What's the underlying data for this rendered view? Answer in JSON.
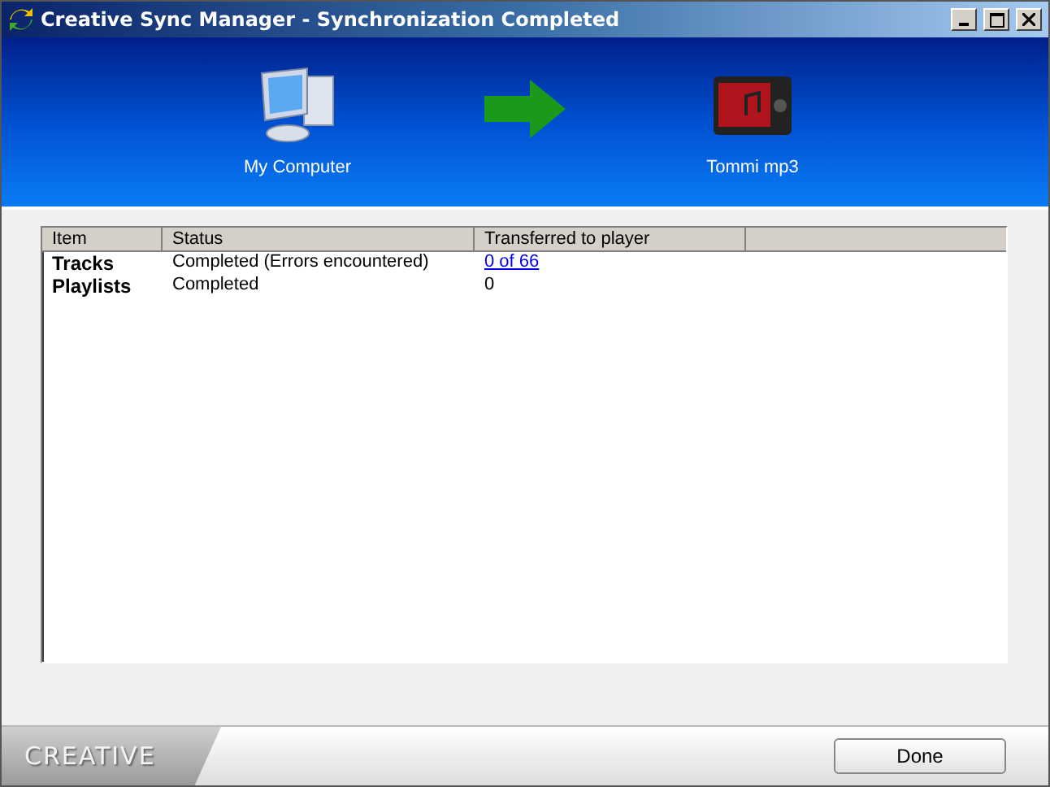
{
  "window": {
    "title": "Creative Sync Manager - Synchronization Completed"
  },
  "header": {
    "source": "My Computer",
    "target": "Tommi mp3"
  },
  "table": {
    "columns": [
      "Item",
      "Status",
      "Transferred to player"
    ],
    "rows": [
      {
        "item": "Tracks",
        "status": "Completed (Errors encountered)",
        "transferred": "0 of 66",
        "kind": "link"
      },
      {
        "item": "Playlists",
        "status": "Completed",
        "transferred": "0",
        "kind": "text"
      }
    ]
  },
  "footer": {
    "logo": "CREATIVE",
    "button": "Done"
  }
}
